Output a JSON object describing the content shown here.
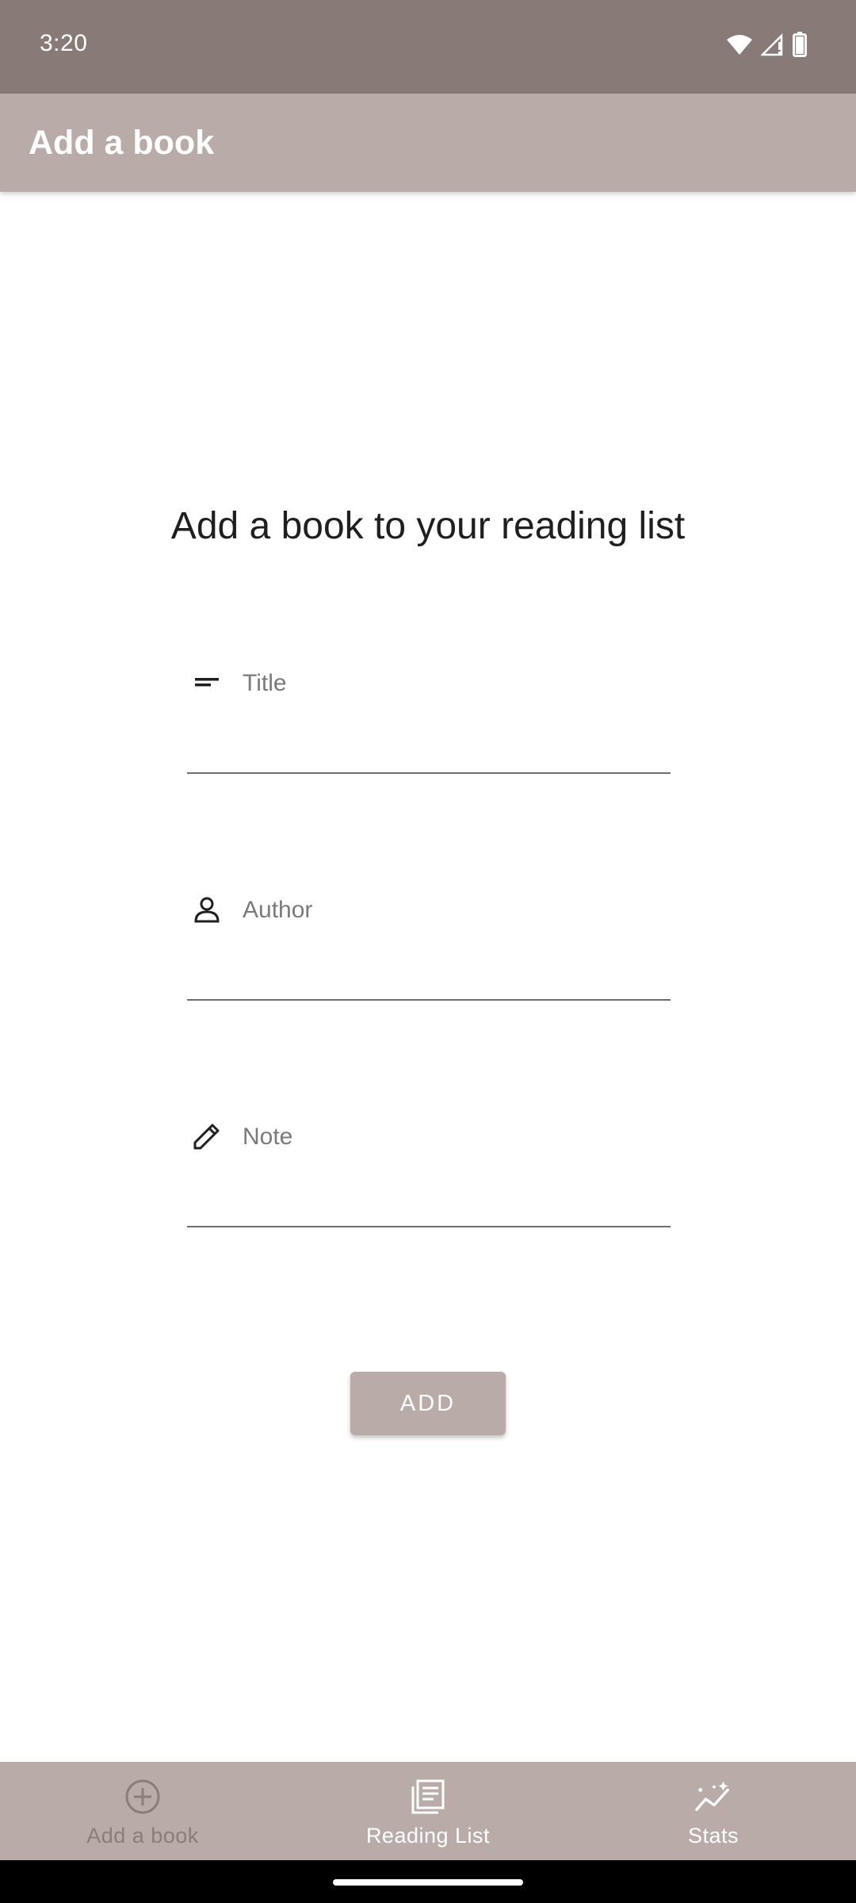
{
  "status_bar": {
    "time": "3:20",
    "icons": [
      "wifi-icon",
      "signal-icon",
      "battery-icon"
    ]
  },
  "app_bar": {
    "title": "Add a book"
  },
  "main": {
    "headline": "Add a book to your reading list",
    "fields": [
      {
        "icon": "short-text-icon",
        "placeholder": "Title",
        "value": ""
      },
      {
        "icon": "person-icon",
        "placeholder": "Author",
        "value": ""
      },
      {
        "icon": "pencil-icon",
        "placeholder": "Note",
        "value": ""
      }
    ],
    "add_button_label": "ADD"
  },
  "bottom_nav": {
    "items": [
      {
        "label": "Add a book",
        "icon": "add-circle-icon",
        "active": false
      },
      {
        "label": "Reading List",
        "icon": "list-icon",
        "active": true
      },
      {
        "label": "Stats",
        "icon": "chart-icon",
        "active": true
      }
    ]
  },
  "colors": {
    "status_bar": "#887a76",
    "primary": "#b9aba7",
    "nav_inactive_text": "#8a7d7a",
    "nav_active_text": "#ffffff"
  }
}
